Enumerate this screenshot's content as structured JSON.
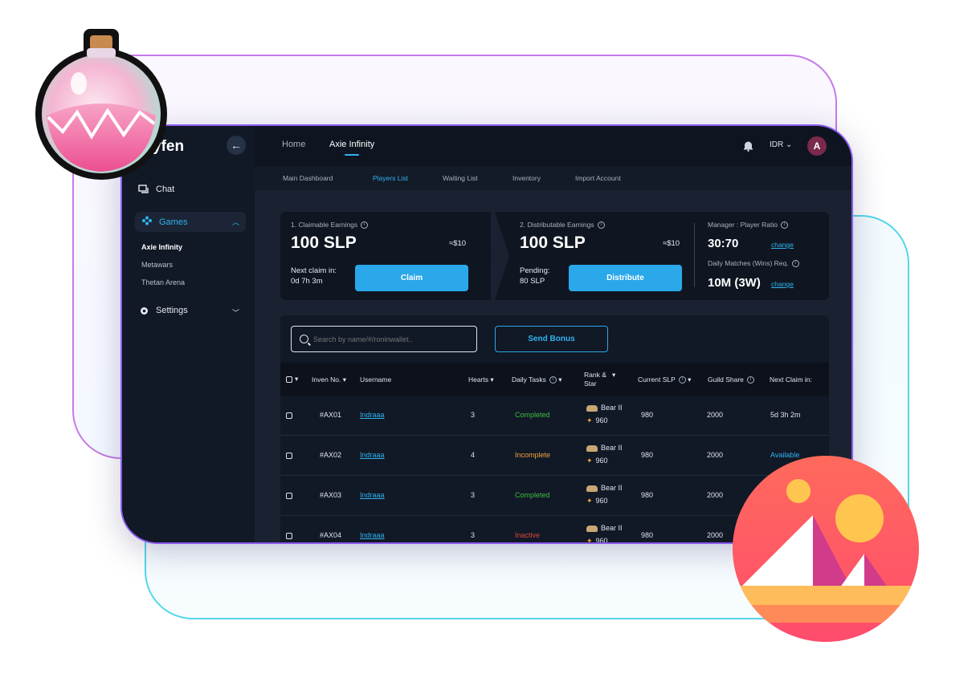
{
  "brand": "yfen",
  "sidebar": {
    "chat": "Chat",
    "games": "Games",
    "sub_items": [
      "Axie Infinity",
      "Metawars",
      "Thetan Arena"
    ],
    "settings": "Settings"
  },
  "topnav": {
    "home": "Home",
    "game": "Axie Infinity",
    "currency": "IDR",
    "avatar_initial": "A"
  },
  "subnav": [
    "Main Dashboard",
    "Players List",
    "Waiting List",
    "Inventory",
    "Import Account"
  ],
  "summary": {
    "claimable_label": "1. Claimable Earnings",
    "claimable_value": "100 SLP",
    "claimable_usd": "≈$10",
    "next_claim_label": "Next claim in:",
    "next_claim_value": "0d 7h 3m",
    "claim_button": "Claim",
    "distributable_label": "2. Distributable Earnings",
    "distributable_value": "100 SLP",
    "distributable_usd": "≈$10",
    "pending_label": "Pending:",
    "pending_value": "80 SLP",
    "distribute_button": "Distribute",
    "ratio_label": "Manager : Player Ratio",
    "ratio_value": "30:70",
    "ratio_change": "change",
    "matches_label": "Daily Matches (Wins) Req.",
    "matches_value": "10M (3W)",
    "matches_change": "change"
  },
  "table": {
    "search_placeholder": "Search by name/#/roninwallet..",
    "send_bonus": "Send Bonus",
    "headers": {
      "inven": "Inven No.",
      "username": "Username",
      "hearts": "Hearts",
      "daily": "Daily Tasks",
      "rank": "Rank &",
      "rank2": "Star",
      "slp": "Current SLP",
      "guild": "Guild  Share",
      "next": "Next Claim in:"
    },
    "rows": [
      {
        "inven": "#AX01",
        "username": "Indraaa",
        "hearts": "3",
        "status": "Completed",
        "rank": "Bear II",
        "star": "960",
        "slp": "980",
        "share": "2000",
        "next": "5d 3h 2m"
      },
      {
        "inven": "#AX02",
        "username": "Indraaa",
        "hearts": "4",
        "status": "Incomplete",
        "rank": "Bear II",
        "star": "960",
        "slp": "980",
        "share": "2000",
        "next": "Available"
      },
      {
        "inven": "#AX03",
        "username": "Indraaa",
        "hearts": "3",
        "status": "Completed",
        "rank": "Bear II",
        "star": "960",
        "slp": "980",
        "share": "2000",
        "next": ""
      },
      {
        "inven": "#AX04",
        "username": "Indraaa",
        "hearts": "3",
        "status": "Inactive",
        "rank": "Bear II",
        "star": "960",
        "slp": "980",
        "share": "2000",
        "next": ""
      }
    ]
  },
  "colors": {
    "accent": "#2fb4ee",
    "completed": "#3fbf3f",
    "incomplete": "#f0a53b",
    "inactive": "#e0453a"
  }
}
